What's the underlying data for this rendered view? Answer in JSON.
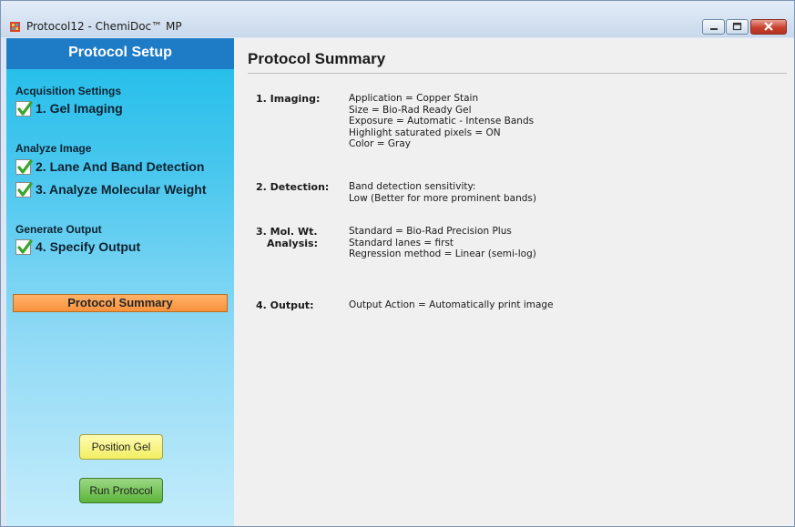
{
  "window": {
    "title": "Protocol12 - ChemiDoc™ MP"
  },
  "sidebar": {
    "header": "Protocol Setup",
    "groups": [
      {
        "title": "Acquisition Settings",
        "steps": [
          {
            "label": "1. Gel Imaging",
            "checked": true
          }
        ]
      },
      {
        "title": "Analyze Image",
        "steps": [
          {
            "label": "2. Lane And Band Detection",
            "checked": true
          },
          {
            "label": "3. Analyze Molecular Weight",
            "checked": true
          }
        ]
      },
      {
        "title": "Generate Output",
        "steps": [
          {
            "label": "4. Specify Output",
            "checked": true
          }
        ]
      }
    ],
    "summary_label": "Protocol Summary",
    "position_gel_label": "Position Gel",
    "run_protocol_label": "Run Protocol"
  },
  "main": {
    "title": "Protocol Summary",
    "sections": [
      {
        "label": "1. Imaging:",
        "lines": [
          "Application = Copper Stain",
          "Size = Bio-Rad Ready Gel",
          "Exposure = Automatic - Intense Bands",
          "Highlight saturated pixels = ON",
          "Color = Gray"
        ]
      },
      {
        "label": "2. Detection:",
        "lines": [
          "Band detection sensitivity:",
          "Low (Better for more prominent bands)"
        ]
      },
      {
        "label_line1": "3. Mol. Wt.",
        "label_line2": "Analysis:",
        "lines": [
          "Standard = Bio-Rad Precision Plus",
          "Standard lanes = first",
          "Regression method = Linear (semi-log)"
        ]
      },
      {
        "label": "4. Output:",
        "lines": [
          "Output Action = Automatically print image"
        ]
      }
    ]
  },
  "colors": {
    "sidebar_header": "#1e7cc6",
    "summary_nav": "#f8923c",
    "position_button": "#f2ee62",
    "run_button": "#5cb43a",
    "check": "#3aa52a"
  }
}
